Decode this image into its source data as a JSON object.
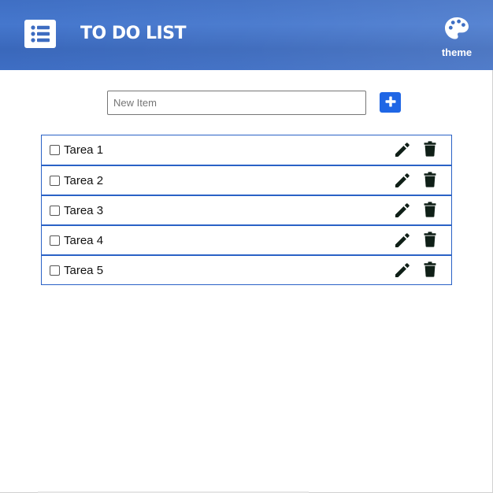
{
  "header": {
    "title": "TO DO LIST",
    "logo_icon": "list-icon",
    "theme_label": "theme",
    "theme_icon": "palette-icon",
    "colors": {
      "header_bg": "#3f6fc4",
      "accent": "#1f66e5",
      "item_border": "#2a62c6"
    }
  },
  "new_item": {
    "value": "",
    "placeholder": "New Item",
    "add_icon": "plus-icon"
  },
  "tasks": [
    {
      "label": "Tarea 1",
      "checked": false
    },
    {
      "label": "Tarea 2",
      "checked": false
    },
    {
      "label": "Tarea 3",
      "checked": false
    },
    {
      "label": "Tarea 4",
      "checked": false
    },
    {
      "label": "Tarea 5",
      "checked": false
    }
  ],
  "task_icons": {
    "edit": "pencil-icon",
    "delete": "trash-icon"
  }
}
